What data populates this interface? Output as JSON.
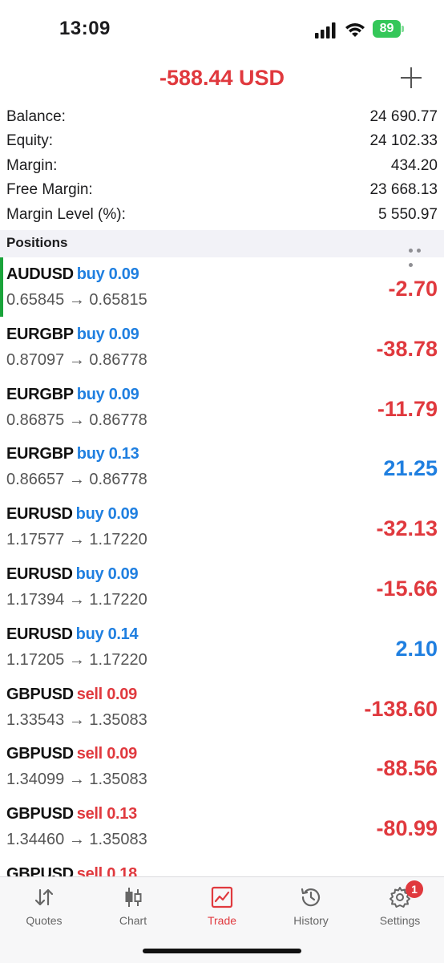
{
  "status": {
    "time": "13:09",
    "battery": "89"
  },
  "header": {
    "total": "-588.44 USD"
  },
  "summary": [
    {
      "label": "Balance:",
      "value": "24 690.77"
    },
    {
      "label": "Equity:",
      "value": "24 102.33"
    },
    {
      "label": "Margin:",
      "value": "434.20"
    },
    {
      "label": "Free Margin:",
      "value": "23 668.13"
    },
    {
      "label": "Margin Level (%):",
      "value": "5 550.97"
    }
  ],
  "positions_title": "Positions",
  "positions": [
    {
      "symbol": "AUDUSD",
      "side": "buy 0.09",
      "prices": "0.65845 → 0.65815",
      "pl": "-2.70"
    },
    {
      "symbol": "EURGBP",
      "side": "buy 0.09",
      "prices": "0.87097 → 0.86778",
      "pl": "-38.78"
    },
    {
      "symbol": "EURGBP",
      "side": "buy 0.09",
      "prices": "0.86875 → 0.86778",
      "pl": "-11.79"
    },
    {
      "symbol": "EURGBP",
      "side": "buy 0.13",
      "prices": "0.86657 → 0.86778",
      "pl": "21.25"
    },
    {
      "symbol": "EURUSD",
      "side": "buy 0.09",
      "prices": "1.17577 → 1.17220",
      "pl": "-32.13"
    },
    {
      "symbol": "EURUSD",
      "side": "buy 0.09",
      "prices": "1.17394 → 1.17220",
      "pl": "-15.66"
    },
    {
      "symbol": "EURUSD",
      "side": "buy 0.14",
      "prices": "1.17205 → 1.17220",
      "pl": "2.10"
    },
    {
      "symbol": "GBPUSD",
      "side": "sell 0.09",
      "prices": "1.33543 → 1.35083",
      "pl": "-138.60"
    },
    {
      "symbol": "GBPUSD",
      "side": "sell 0.09",
      "prices": "1.34099 → 1.35083",
      "pl": "-88.56"
    },
    {
      "symbol": "GBPUSD",
      "side": "sell 0.13",
      "prices": "1.34460 → 1.35083",
      "pl": "-80.99"
    },
    {
      "symbol": "GBPUSD",
      "side": "sell 0.18",
      "prices": "",
      "pl": ""
    }
  ],
  "tabs": [
    {
      "label": "Quotes",
      "icon": "quotes-arrows-icon"
    },
    {
      "label": "Chart",
      "icon": "candlestick-icon"
    },
    {
      "label": "Trade",
      "icon": "trade-chart-icon"
    },
    {
      "label": "History",
      "icon": "history-clock-icon"
    },
    {
      "label": "Settings",
      "icon": "gear-icon",
      "badge": "1"
    }
  ],
  "colors": {
    "negative": "#e0393e",
    "positive": "#1f7fe0",
    "active_marker": "#1aa33a"
  }
}
